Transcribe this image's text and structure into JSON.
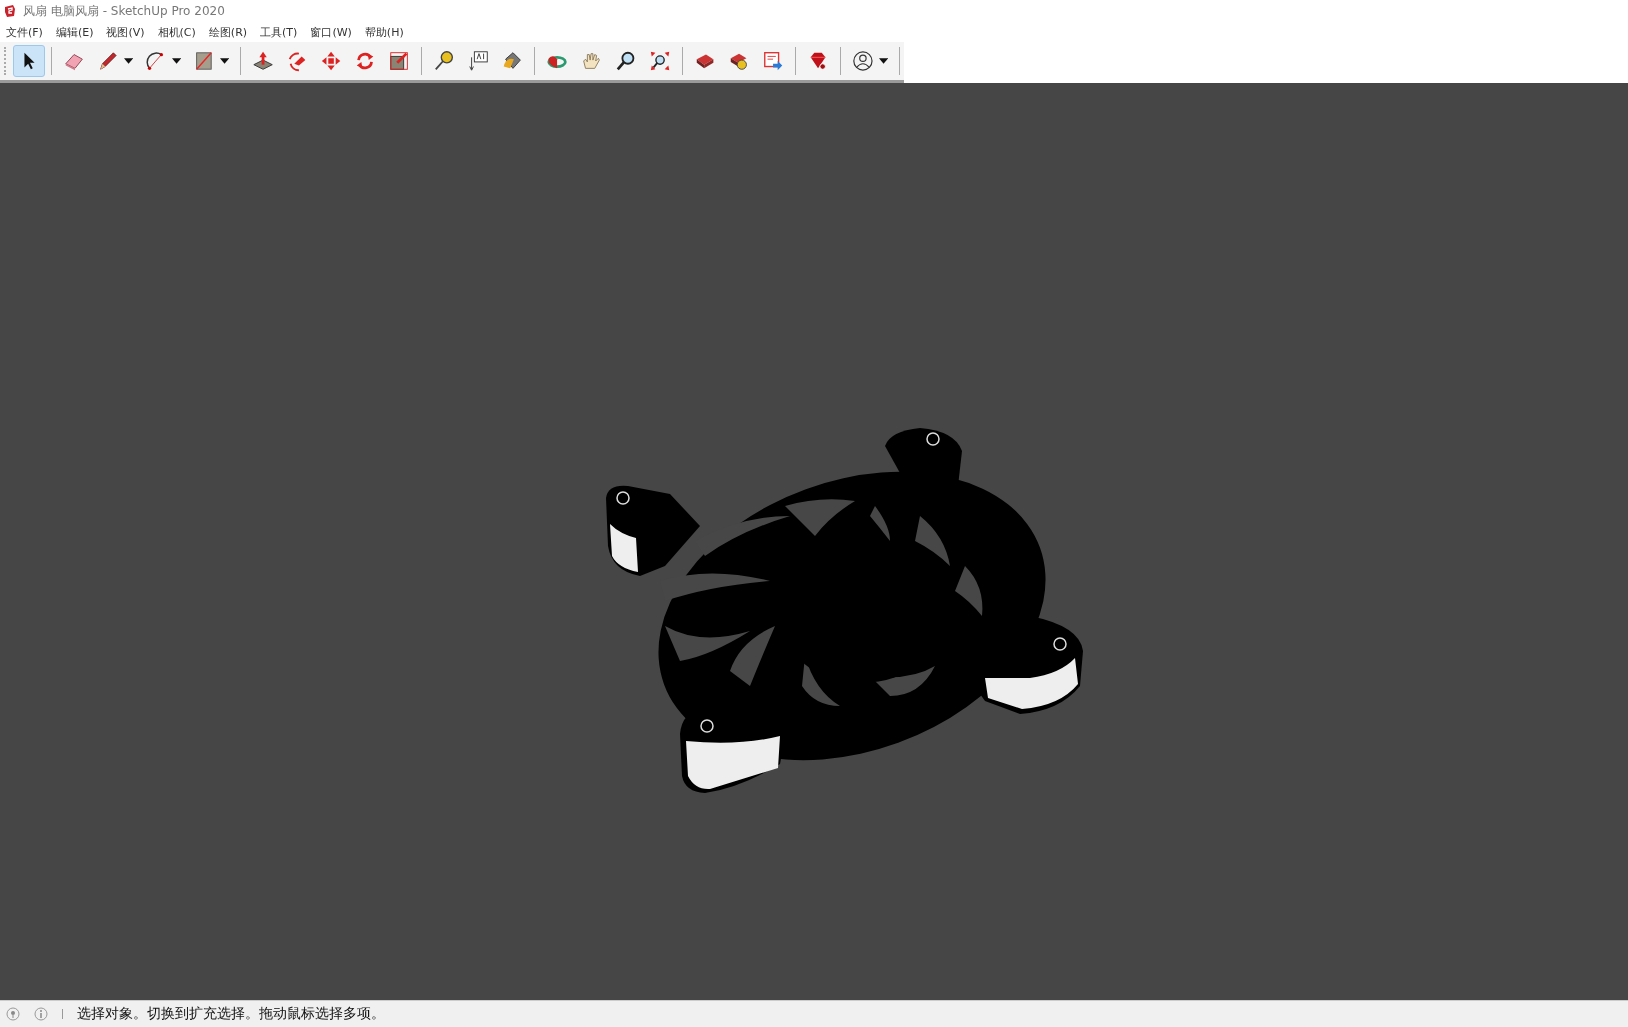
{
  "window": {
    "title": "风扇 电脑风扇 - SketchUp Pro 2020"
  },
  "menu": [
    "文件(F)",
    "编辑(E)",
    "视图(V)",
    "相机(C)",
    "绘图(R)",
    "工具(T)",
    "窗口(W)",
    "帮助(H)"
  ],
  "toolbar": {
    "groups": [
      {
        "tools": [
          {
            "kind": "select",
            "selected": true,
            "dropdown": false
          }
        ]
      },
      {
        "tools": [
          {
            "kind": "eraser",
            "selected": false,
            "dropdown": false
          },
          {
            "kind": "pencil",
            "selected": false,
            "dropdown": true
          },
          {
            "kind": "arc",
            "selected": false,
            "dropdown": true
          },
          {
            "kind": "rectangle",
            "selected": false,
            "dropdown": true
          }
        ]
      },
      {
        "tools": [
          {
            "kind": "pushpull",
            "selected": false,
            "dropdown": false
          },
          {
            "kind": "followme",
            "selected": false,
            "dropdown": false
          },
          {
            "kind": "move",
            "selected": false,
            "dropdown": false
          },
          {
            "kind": "rotate",
            "selected": false,
            "dropdown": false
          },
          {
            "kind": "scale",
            "selected": false,
            "dropdown": false
          }
        ]
      },
      {
        "tools": [
          {
            "kind": "tape",
            "selected": false,
            "dropdown": false
          },
          {
            "kind": "text",
            "selected": false,
            "dropdown": false
          },
          {
            "kind": "paint",
            "selected": false,
            "dropdown": false
          }
        ]
      },
      {
        "tools": [
          {
            "kind": "orbit",
            "selected": false,
            "dropdown": false
          },
          {
            "kind": "pan",
            "selected": false,
            "dropdown": false
          },
          {
            "kind": "zoom",
            "selected": false,
            "dropdown": false
          },
          {
            "kind": "extents",
            "selected": false,
            "dropdown": false
          }
        ]
      },
      {
        "tools": [
          {
            "kind": "warehouse",
            "selected": false,
            "dropdown": false
          },
          {
            "kind": "extensions",
            "selected": false,
            "dropdown": false
          },
          {
            "kind": "layout",
            "selected": false,
            "dropdown": false
          }
        ]
      },
      {
        "tools": [
          {
            "kind": "ruby",
            "selected": false,
            "dropdown": false
          }
        ]
      },
      {
        "tools": [
          {
            "kind": "account",
            "selected": false,
            "dropdown": true
          }
        ]
      }
    ]
  },
  "status_bar": {
    "message": "选择对象。切换到扩充选择。拖动鼠标选择多项。"
  }
}
